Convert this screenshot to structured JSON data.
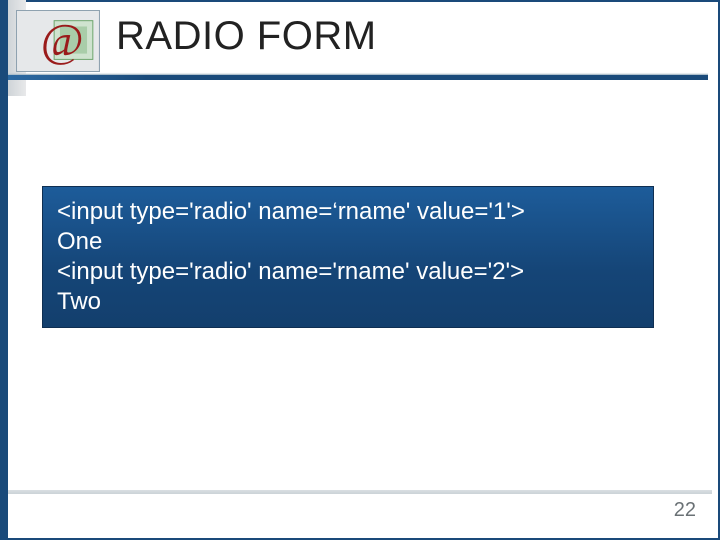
{
  "corner_icon_name": "at-sign-money-icon",
  "title": "RADIO FORM",
  "code": {
    "line1": "<input type='radio' name=‘rname' value='1'>",
    "line2": "One",
    "line3": "<input type='radio' name='rname' value='2'>",
    "line4": "Two"
  },
  "page_number": "22",
  "accent_color": "#1a4a7a"
}
